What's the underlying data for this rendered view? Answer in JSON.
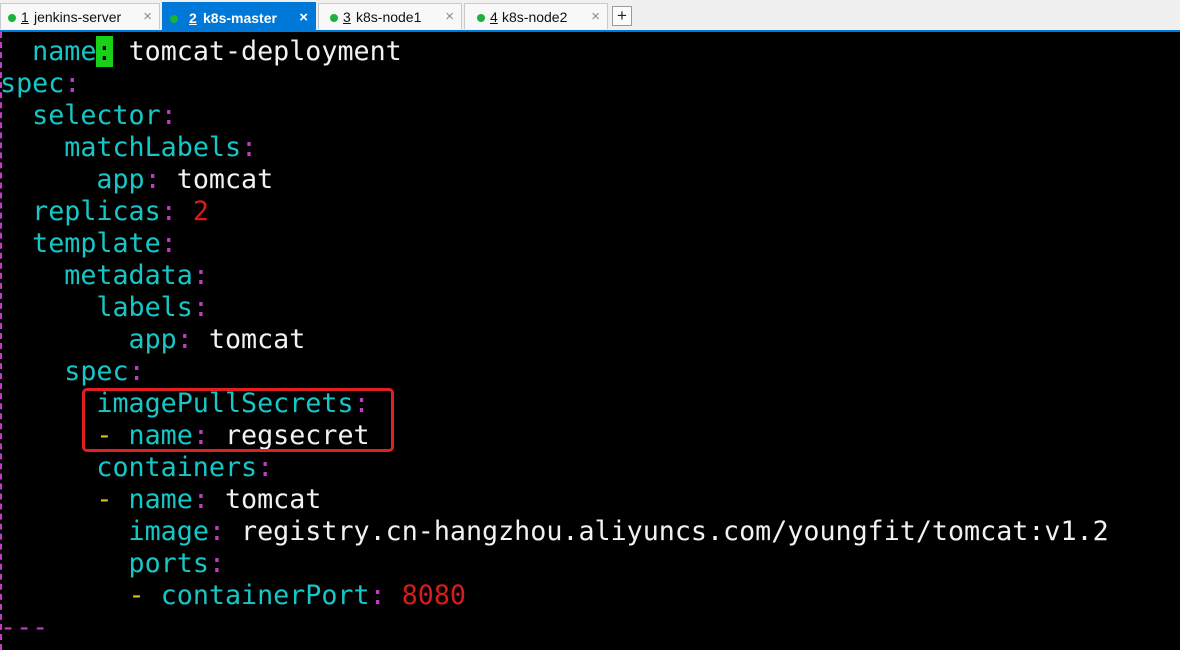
{
  "tabs": [
    {
      "num": "1",
      "label": "jenkins-server",
      "active": false
    },
    {
      "num": "2",
      "label": "k8s-master",
      "active": true
    },
    {
      "num": "3",
      "label": "k8s-node1",
      "active": false
    },
    {
      "num": "4",
      "label": "k8s-node2",
      "active": false
    }
  ],
  "tab_close_glyph": "×",
  "add_tab_glyph": "+",
  "editor": {
    "lines": [
      {
        "indent": "  ",
        "dash": "",
        "key": "nam",
        "cursor": "e",
        "colon": ":",
        "value": " tomcat-deployment",
        "type": "v"
      },
      {
        "indent": "",
        "dash": "",
        "key": "spec",
        "colon": ":",
        "value": "",
        "type": "v"
      },
      {
        "indent": "  ",
        "dash": "",
        "key": "selector",
        "colon": ":",
        "value": "",
        "type": "v"
      },
      {
        "indent": "    ",
        "dash": "",
        "key": "matchLabels",
        "colon": ":",
        "value": "",
        "type": "v"
      },
      {
        "indent": "      ",
        "dash": "",
        "key": "app",
        "colon": ":",
        "value": " tomcat",
        "type": "v"
      },
      {
        "indent": "  ",
        "dash": "",
        "key": "replicas",
        "colon": ":",
        "value": " 2",
        "type": "n"
      },
      {
        "indent": "  ",
        "dash": "",
        "key": "template",
        "colon": ":",
        "value": "",
        "type": "v"
      },
      {
        "indent": "    ",
        "dash": "",
        "key": "metadata",
        "colon": ":",
        "value": "",
        "type": "v"
      },
      {
        "indent": "      ",
        "dash": "",
        "key": "labels",
        "colon": ":",
        "value": "",
        "type": "v"
      },
      {
        "indent": "        ",
        "dash": "",
        "key": "app",
        "colon": ":",
        "value": " tomcat",
        "type": "v"
      },
      {
        "indent": "    ",
        "dash": "",
        "key": "spec",
        "colon": ":",
        "value": "",
        "type": "v"
      },
      {
        "indent": "      ",
        "dash": "",
        "key": "imagePullSecrets",
        "colon": ":",
        "value": "",
        "type": "v"
      },
      {
        "indent": "      ",
        "dash": "- ",
        "key": "name",
        "colon": ":",
        "value": " regsecret",
        "type": "v"
      },
      {
        "indent": "      ",
        "dash": "",
        "key": "containers",
        "colon": ":",
        "value": "",
        "type": "v"
      },
      {
        "indent": "      ",
        "dash": "- ",
        "key": "name",
        "colon": ":",
        "value": " tomcat",
        "type": "v"
      },
      {
        "indent": "        ",
        "dash": "",
        "key": "image",
        "colon": ":",
        "value": " registry.cn-hangzhou.aliyuncs.com/youngfit/tomcat:v1.2",
        "type": "v"
      },
      {
        "indent": "        ",
        "dash": "",
        "key": "ports",
        "colon": ":",
        "value": "",
        "type": "v"
      },
      {
        "indent": "        ",
        "dash": "- ",
        "key": "containerPort",
        "colon": ":",
        "value": " 8080",
        "type": "n"
      },
      {
        "indent": "",
        "dash": "",
        "key": "",
        "colon": "",
        "value": "",
        "marker": "---",
        "type": "v"
      }
    ]
  }
}
